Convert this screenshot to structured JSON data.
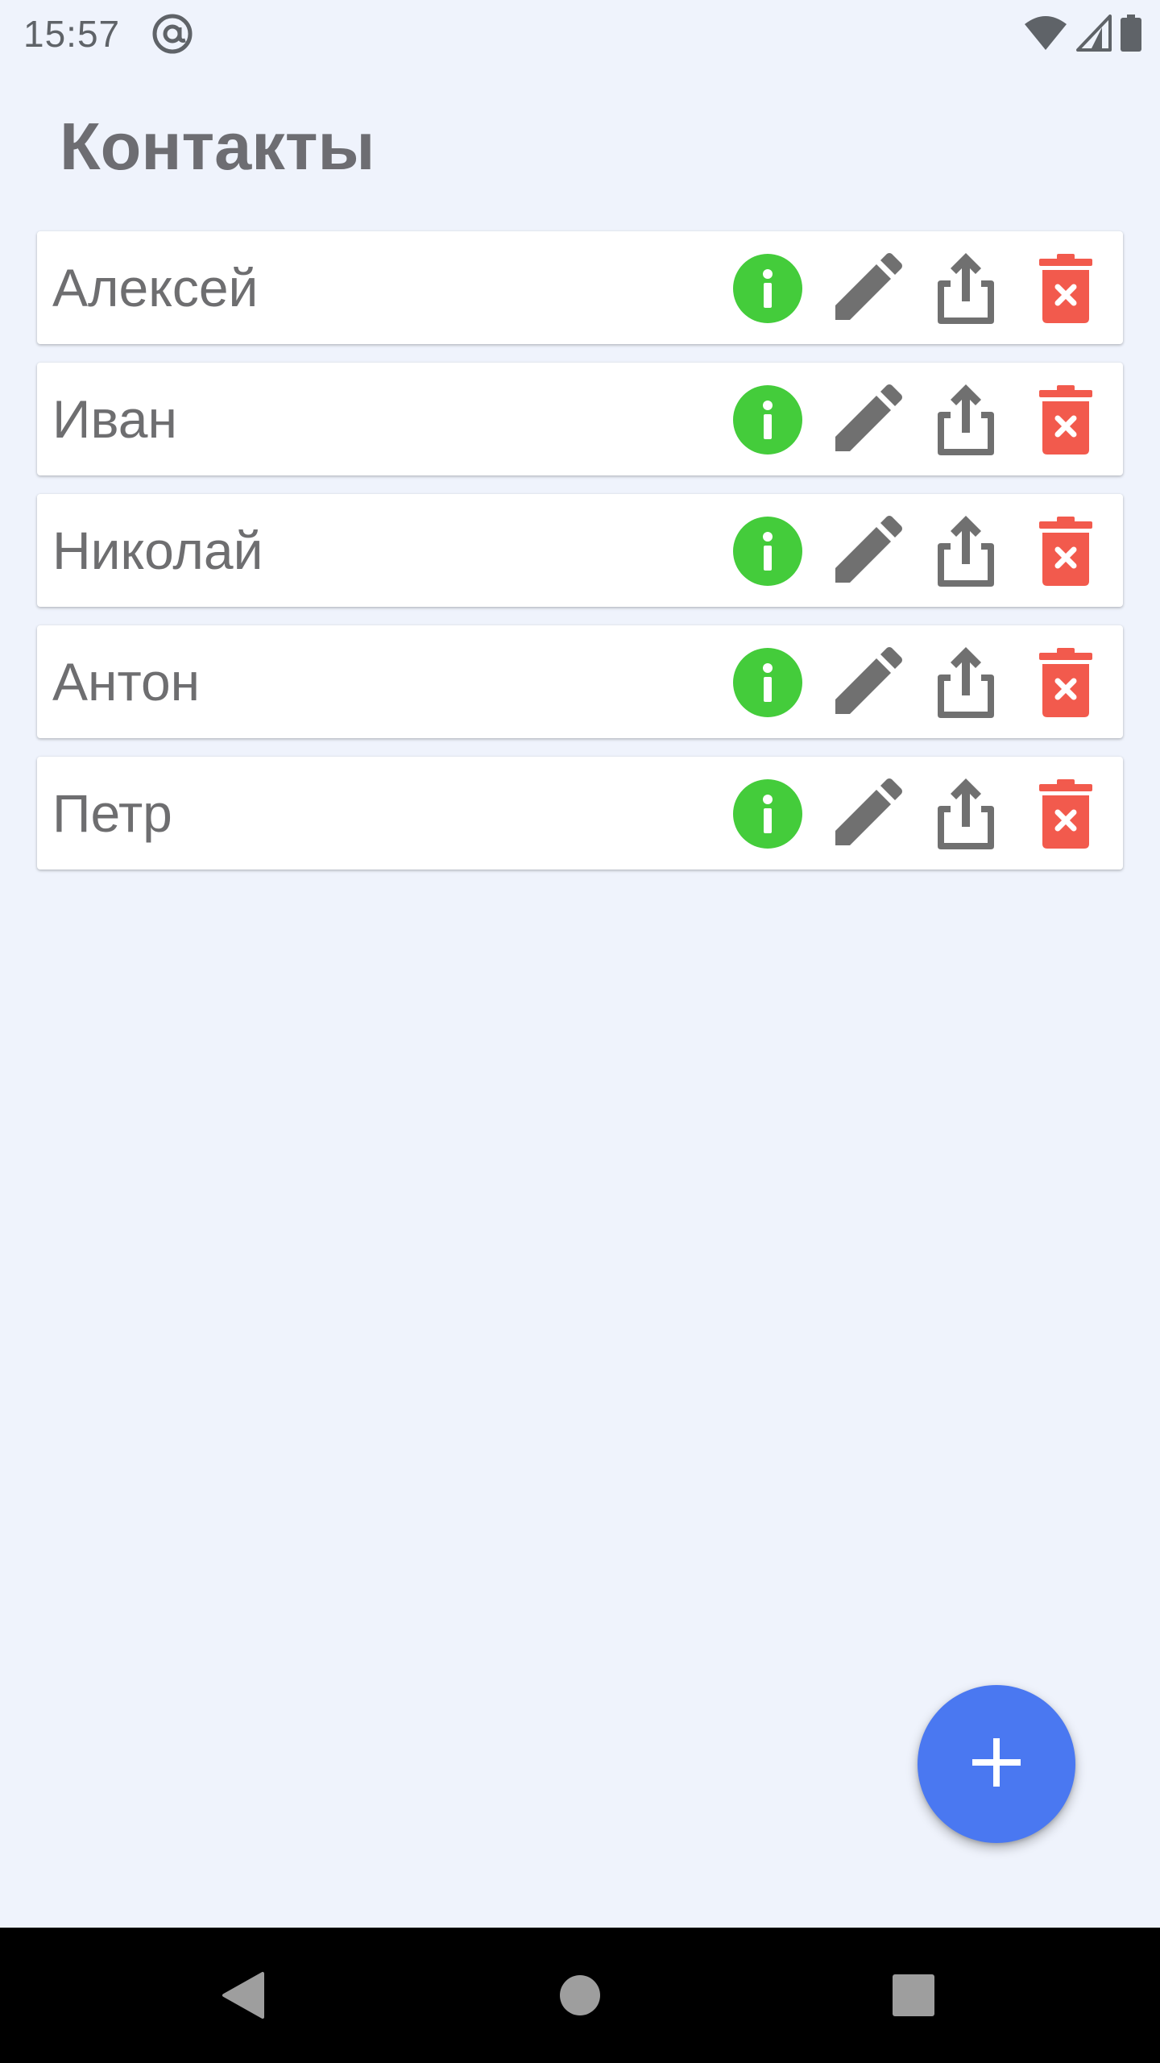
{
  "status_bar": {
    "time": "15:57",
    "icons": [
      "at-sign-icon",
      "wifi-icon",
      "cell-signal-icon",
      "battery-icon"
    ]
  },
  "header": {
    "title": "Контакты"
  },
  "contacts": [
    {
      "name": "Алексей"
    },
    {
      "name": "Иван"
    },
    {
      "name": "Николай"
    },
    {
      "name": "Антон"
    },
    {
      "name": "Петр"
    }
  ],
  "row_actions": [
    "info-icon",
    "edit-pencil-icon",
    "share-icon",
    "delete-trash-icon"
  ],
  "fab": {
    "icon": "plus-icon"
  },
  "navigation_bar": {
    "buttons": [
      "back-triangle-icon",
      "home-circle-icon",
      "recents-square-icon"
    ]
  },
  "colors": {
    "background": "#eff3fc",
    "card": "#ffffff",
    "info_green": "#44cc3b",
    "delete_red": "#f25a4d",
    "icon_gray": "#707070",
    "fab_blue": "#4a78f1",
    "title_gray": "#6d6d72",
    "nav_bar": "#000000"
  }
}
